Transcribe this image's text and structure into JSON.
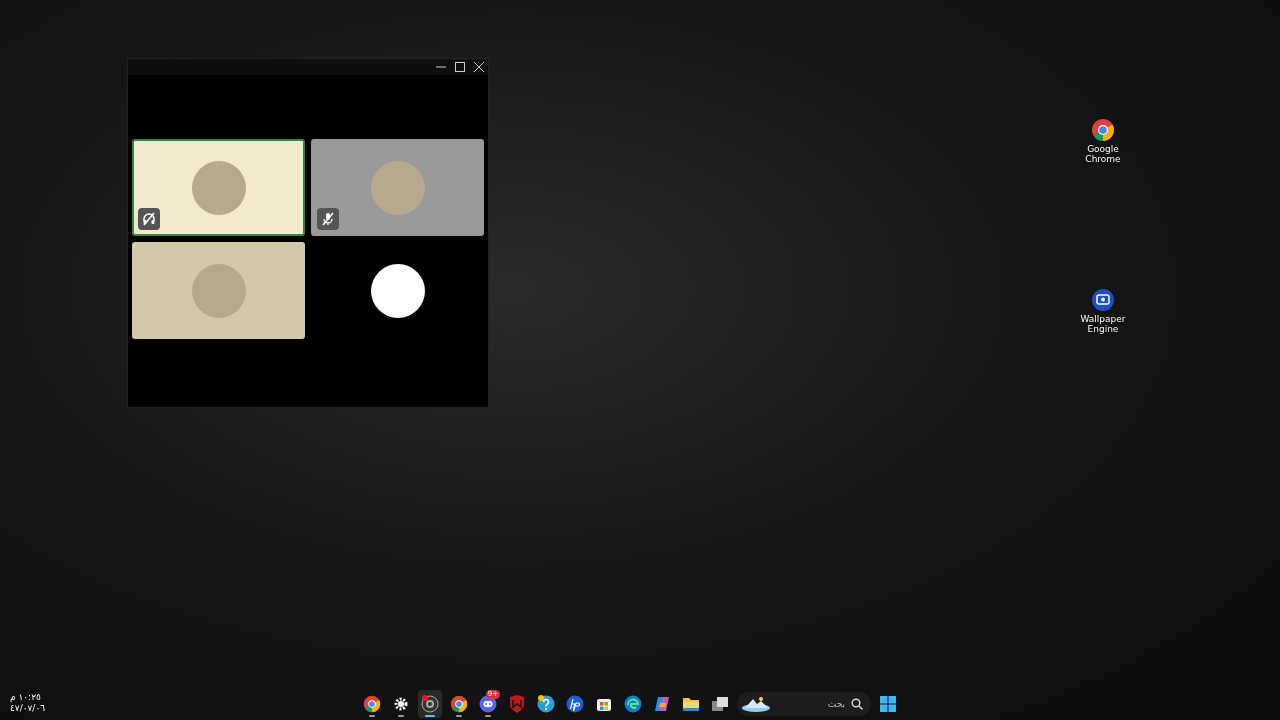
{
  "call_window": {
    "tiles": [
      {
        "kind": "photo",
        "speaking": true,
        "color": "#f3e9cc",
        "deafened": true,
        "muted": false
      },
      {
        "kind": "photo",
        "speaking": false,
        "color": "#9a9a9a",
        "deafened": false,
        "muted": true
      },
      {
        "kind": "photo",
        "speaking": false,
        "color": "#d3c9a9",
        "deafened": false,
        "muted": false
      },
      {
        "kind": "blank",
        "speaking": false,
        "color": "#000000",
        "deafened": false,
        "muted": false
      }
    ]
  },
  "desktop_icons": [
    {
      "label": "Google Chrome",
      "kind": "chrome"
    },
    {
      "label": "Wallpaper Engine",
      "kind": "wallpaper"
    }
  ],
  "taskbar": {
    "clock": {
      "time": "١٠:٢٥ م",
      "date": "٤٧/٠٧/٠٦"
    },
    "apps": [
      {
        "kind": "chrome",
        "running": true,
        "active": false
      },
      {
        "kind": "gear",
        "running": true,
        "active": false
      },
      {
        "kind": "record",
        "running": true,
        "active": true
      },
      {
        "kind": "chrome",
        "running": true,
        "active": false
      },
      {
        "kind": "chat",
        "running": true,
        "active": false,
        "badge": "9+"
      },
      {
        "kind": "shield",
        "running": false,
        "active": false
      },
      {
        "kind": "help",
        "running": false,
        "active": false
      },
      {
        "kind": "hp",
        "running": false,
        "active": false
      },
      {
        "kind": "store",
        "running": false,
        "active": false
      },
      {
        "kind": "edge",
        "running": false,
        "active": false
      },
      {
        "kind": "copilot",
        "running": false,
        "active": false
      },
      {
        "kind": "folder",
        "running": false,
        "active": false
      },
      {
        "kind": "windows",
        "running": false,
        "active": false
      }
    ],
    "search": {
      "placeholder": "بحث"
    }
  }
}
